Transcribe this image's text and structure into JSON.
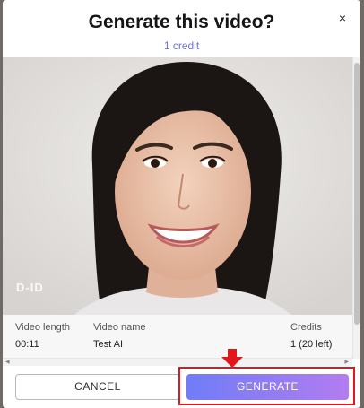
{
  "dialog": {
    "title": "Generate this video?",
    "close_glyph": "×",
    "credit_cost": "1 credit",
    "watermark": "D-ID"
  },
  "details": {
    "length_label": "Video length",
    "length_value": "00:11",
    "name_label": "Video name",
    "name_value": "Test AI",
    "credits_label": "Credits",
    "credits_value": "1 (20 left)"
  },
  "actions": {
    "cancel_label": "CANCEL",
    "generate_label": "GENERATE"
  },
  "annotation": {
    "color": "#e3161b",
    "icon": "arrow-down-icon"
  },
  "colors": {
    "accent_text": "#6c72d6",
    "generate_gradient_start": "#6f7df7",
    "generate_gradient_end": "#b37cf0"
  }
}
